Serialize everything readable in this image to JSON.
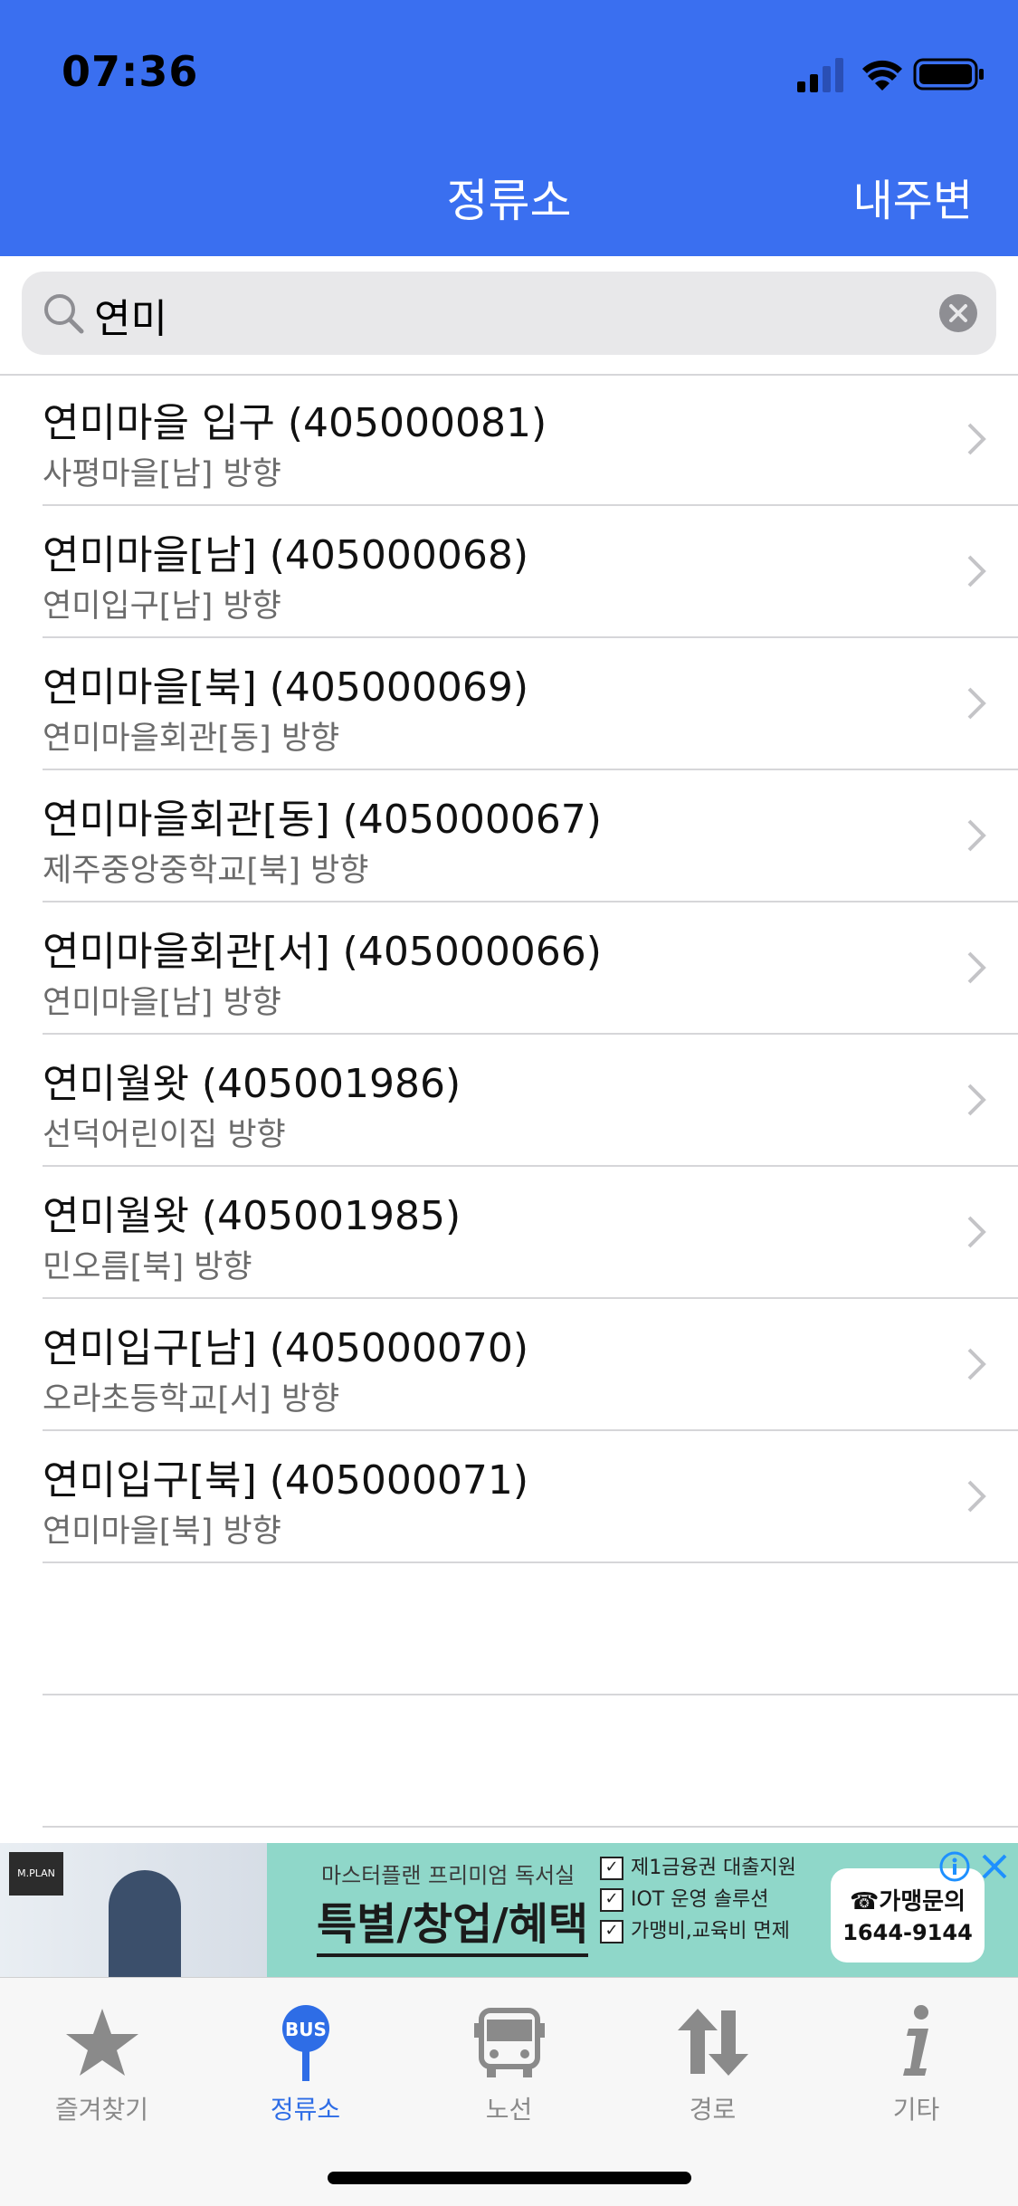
{
  "status": {
    "time": "07:36"
  },
  "nav": {
    "title": "정류소",
    "right_button": "내주변"
  },
  "search": {
    "query": "연미"
  },
  "results": [
    {
      "title": "연미마을 입구 (405000081)",
      "direction": "사평마을[남] 방향"
    },
    {
      "title": "연미마을[남] (405000068)",
      "direction": "연미입구[남] 방향"
    },
    {
      "title": "연미마을[북] (405000069)",
      "direction": "연미마을회관[동] 방향"
    },
    {
      "title": "연미마을회관[동] (405000067)",
      "direction": "제주중앙중학교[북] 방향"
    },
    {
      "title": "연미마을회관[서] (405000066)",
      "direction": "연미마을[남] 방향"
    },
    {
      "title": "연미월왓 (405001986)",
      "direction": "선덕어린이집 방향"
    },
    {
      "title": "연미월왓 (405001985)",
      "direction": "민오름[북] 방향"
    },
    {
      "title": "연미입구[남] (405000070)",
      "direction": "오라초등학교[서] 방향"
    },
    {
      "title": "연미입구[북] (405000071)",
      "direction": "연미마을[북] 방향"
    }
  ],
  "ad": {
    "logo": "M.PLAN",
    "brand": "마스터플랜 프리미엄 독서실",
    "headline": "특별/창업/혜택",
    "checks": [
      "제1금융권 대출지원",
      "IOT 운영 솔루션",
      "가맹비,교육비 면제"
    ],
    "call_label": "가맹문의",
    "phone": "1644-9144"
  },
  "tabs": [
    {
      "label": "즐겨찾기",
      "icon": "star-icon",
      "active": false
    },
    {
      "label": "정류소",
      "icon": "bus-stop-icon",
      "active": true
    },
    {
      "label": "노선",
      "icon": "bus-icon",
      "active": false
    },
    {
      "label": "경로",
      "icon": "route-arrows-icon",
      "active": false
    },
    {
      "label": "기타",
      "icon": "info-icon",
      "active": false
    }
  ],
  "colors": {
    "header": "#3a6ff0",
    "active_tab": "#2e6de6",
    "inactive_tab": "#8a8a8a"
  }
}
